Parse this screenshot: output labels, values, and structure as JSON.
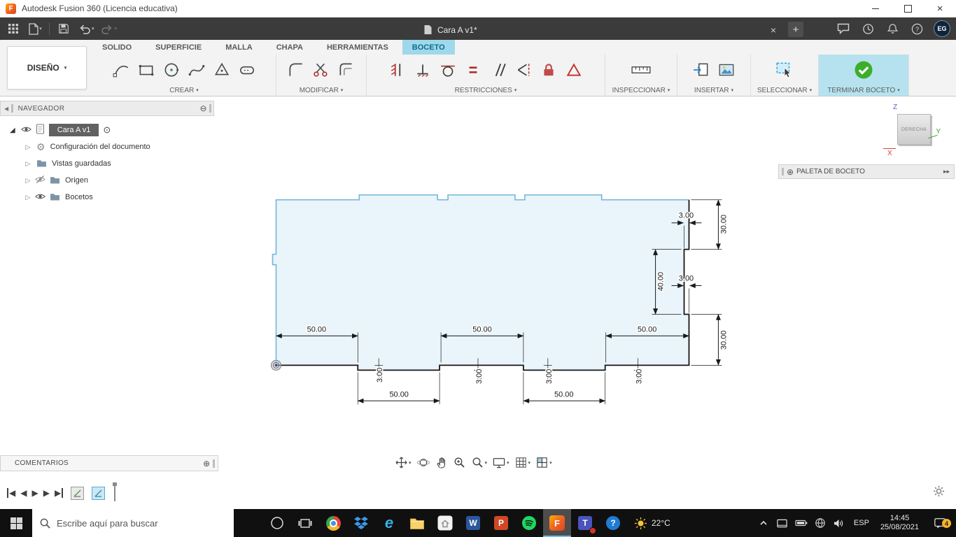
{
  "titlebar": {
    "title": "Autodesk Fusion 360 (Licencia educativa)"
  },
  "appbar": {
    "doc_tab": "Cara A v1*",
    "new_tab": "+",
    "avatar": "EG"
  },
  "ribbon": {
    "design": "DISEÑO",
    "tabs": [
      "SOLIDO",
      "SUPERFICIE",
      "MALLA",
      "CHAPA",
      "HERRAMIENTAS",
      "BOCETO"
    ],
    "active_tab": "BOCETO",
    "groups": [
      "CREAR",
      "MODIFICAR",
      "RESTRICCIONES",
      "INSPECCIONAR",
      "INSERTAR",
      "SELECCIONAR",
      "TERMINAR BOCETO"
    ]
  },
  "navigator": {
    "header": "NAVEGADOR",
    "root": "Cara A v1",
    "items": [
      "Configuración del documento",
      "Vistas guardadas",
      "Origen",
      "Bocetos"
    ]
  },
  "viewcube": {
    "face": "DERECHA",
    "z": "Z",
    "y": "Y",
    "x": "X"
  },
  "palette": {
    "header": "PALETA DE BOCETO"
  },
  "comments": {
    "header": "COMENTARIOS"
  },
  "sketch": {
    "dims": {
      "d3_top": "3.00",
      "d30_top": "30.00",
      "d40": "40.00",
      "d3_mid": "3.00",
      "d30_bottom": "30.00",
      "d50_a": "50.00",
      "d50_b": "50.00",
      "d50_c": "50.00",
      "d50_d": "50.00",
      "d50_e": "50.00",
      "d3_b1": "3.00",
      "d3_b2": "3.00",
      "d3_b3": "3.00",
      "d3_b4": "3.00"
    },
    "colors": {
      "fill": "#e9f4fb",
      "profile_blue": "#74b6d9",
      "profile_dark": "#161616",
      "dimension": "#1a1a1a"
    }
  },
  "taskbar": {
    "search_placeholder": "Escribe aquí para buscar",
    "weather": "22°C",
    "lang": "ESP",
    "time": "14:45",
    "date": "25/08/2021",
    "badge": "4"
  }
}
